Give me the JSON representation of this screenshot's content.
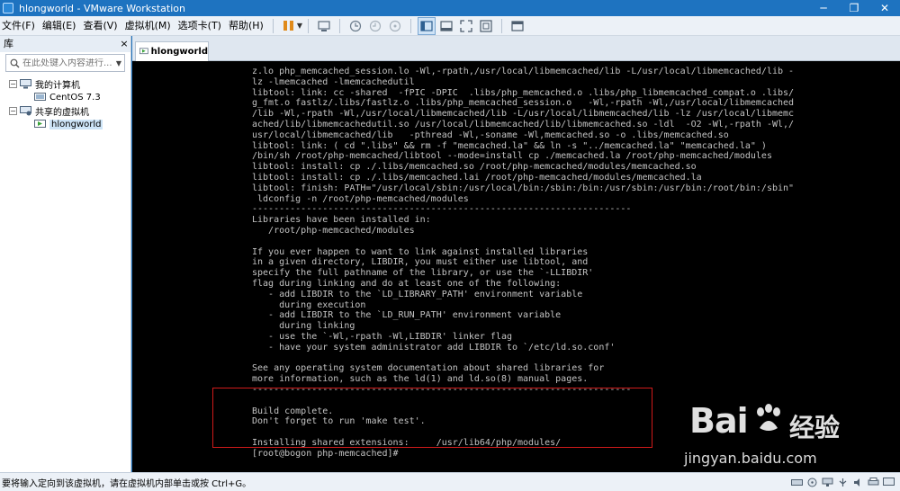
{
  "window": {
    "title": "hlongworld - VMware Workstation",
    "controls": {
      "minimize": "─",
      "restore": "❐",
      "close": "✕"
    }
  },
  "menu": {
    "items": [
      "文件(F)",
      "编辑(E)",
      "查看(V)",
      "虚拟机(M)",
      "选项卡(T)",
      "帮助(H)"
    ]
  },
  "toolbar": {
    "icons": [
      "pause-icon",
      "send-ctrl-alt-del-icon",
      "snapshot-icon",
      "revert-snapshot-icon",
      "snapshot-manager-icon",
      "show-library-icon",
      "thumbnail-bar-icon",
      "full-screen-icon",
      "unity-icon",
      "console-view-icon"
    ]
  },
  "library": {
    "title": "库",
    "close_glyph": "×",
    "search_placeholder": "在此处键入内容进行...",
    "tree": {
      "my_computer": "我的计算机",
      "centos": "CentOS 7.3",
      "shared_vms": "共享的虚拟机",
      "hlongworld": "hlongworld"
    }
  },
  "tabs": [
    {
      "label": "hlongworld",
      "active": true
    }
  ],
  "terminal": {
    "lines": [
      "z.lo php_memcached_session.lo -Wl,-rpath,/usr/local/libmemcached/lib -L/usr/local/libmemcached/lib -",
      "lz -lmemcached -lmemcachedutil",
      "libtool: link: cc -shared  -fPIC -DPIC  .libs/php_memcached.o .libs/php_libmemcached_compat.o .libs/",
      "g_fmt.o fastlz/.libs/fastlz.o .libs/php_memcached_session.o   -Wl,-rpath -Wl,/usr/local/libmemcached",
      "/lib -Wl,-rpath -Wl,/usr/local/libmemcached/lib -L/usr/local/libmemcached/lib -lz /usr/local/libmemc",
      "ached/lib/libmemcachedutil.so /usr/local/libmemcached/lib/libmemcached.so -ldl  -O2 -Wl,-rpath -Wl,/",
      "usr/local/libmemcached/lib   -pthread -Wl,-soname -Wl,memcached.so -o .libs/memcached.so",
      "libtool: link: ( cd \".libs\" && rm -f \"memcached.la\" && ln -s \"../memcached.la\" \"memcached.la\" )",
      "/bin/sh /root/php-memcached/libtool --mode=install cp ./memcached.la /root/php-memcached/modules",
      "libtool: install: cp ./.libs/memcached.so /root/php-memcached/modules/memcached.so",
      "libtool: install: cp ./.libs/memcached.lai /root/php-memcached/modules/memcached.la",
      "libtool: finish: PATH=\"/usr/local/sbin:/usr/local/bin:/sbin:/bin:/usr/sbin:/usr/bin:/root/bin:/sbin\"",
      " ldconfig -n /root/php-memcached/modules",
      "----------------------------------------------------------------------",
      "Libraries have been installed in:",
      "   /root/php-memcached/modules",
      "",
      "If you ever happen to want to link against installed libraries",
      "in a given directory, LIBDIR, you must either use libtool, and",
      "specify the full pathname of the library, or use the `-LLIBDIR'",
      "flag during linking and do at least one of the following:",
      "   - add LIBDIR to the `LD_LIBRARY_PATH' environment variable",
      "     during execution",
      "   - add LIBDIR to the `LD_RUN_PATH' environment variable",
      "     during linking",
      "   - use the `-Wl,-rpath -Wl,LIBDIR' linker flag",
      "   - have your system administrator add LIBDIR to `/etc/ld.so.conf'",
      "",
      "See any operating system documentation about shared libraries for",
      "more information, such as the ld(1) and ld.so(8) manual pages.",
      "----------------------------------------------------------------------",
      "",
      "Build complete.",
      "Don't forget to run 'make test'.",
      "",
      "Installing shared extensions:     /usr/lib64/php/modules/",
      "[root@bogon php-memcached]#"
    ]
  },
  "status": {
    "text": "要将输入定向到该虚拟机，请在虚拟机内部单击或按 Ctrl+G。"
  },
  "watermark": {
    "logo": "Bai",
    "logo_tail": "经验",
    "site": "jingyan.baidu.com"
  }
}
